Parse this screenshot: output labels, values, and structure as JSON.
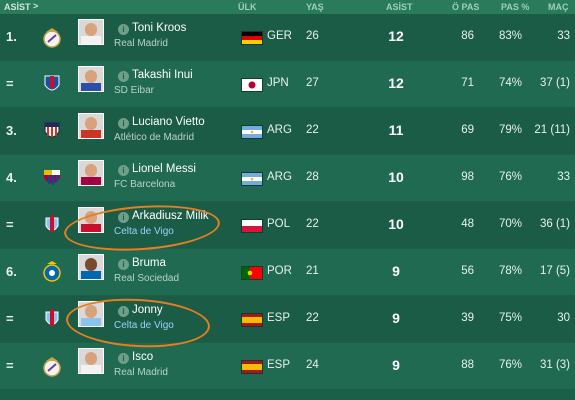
{
  "header": {
    "title": "ASİST",
    "chevron": ">",
    "columns": {
      "nation": "ÜLK",
      "age": "YAŞ",
      "assists": "ASİST",
      "passes": "Ö PAS",
      "pass_pct": "PAS %",
      "apps": "MAÇ"
    }
  },
  "players": [
    {
      "rank": "1.",
      "name": "Toni Kroos",
      "club": "Real Madrid",
      "nation": "GER",
      "age": "26",
      "assists": "12",
      "passes": "86",
      "pass_pct": "83%",
      "apps": "33",
      "badge_icon": "real-madrid-badge-icon",
      "flag_icon": "germany-flag-icon"
    },
    {
      "rank": "=",
      "name": "Takashi Inui",
      "club": "SD Eibar",
      "nation": "JPN",
      "age": "27",
      "assists": "12",
      "passes": "71",
      "pass_pct": "74%",
      "apps": "37 (1)",
      "badge_icon": "eibar-badge-icon",
      "flag_icon": "japan-flag-icon"
    },
    {
      "rank": "3.",
      "name": "Luciano Vietto",
      "club": "Atlético de Madrid",
      "nation": "ARG",
      "age": "22",
      "assists": "11",
      "passes": "69",
      "pass_pct": "79%",
      "apps": "21 (11)",
      "badge_icon": "atletico-badge-icon",
      "flag_icon": "argentina-flag-icon"
    },
    {
      "rank": "4.",
      "name": "Lionel Messi",
      "club": "FC Barcelona",
      "nation": "ARG",
      "age": "28",
      "assists": "10",
      "passes": "98",
      "pass_pct": "76%",
      "apps": "33",
      "badge_icon": "barcelona-badge-icon",
      "flag_icon": "argentina-flag-icon"
    },
    {
      "rank": "=",
      "name": "Arkadiusz Milik",
      "club": "Celta de Vigo",
      "nation": "POL",
      "age": "22",
      "assists": "10",
      "passes": "48",
      "pass_pct": "70%",
      "apps": "36 (1)",
      "badge_icon": "celta-badge-icon",
      "flag_icon": "poland-flag-icon"
    },
    {
      "rank": "6.",
      "name": "Bruma",
      "club": "Real Sociedad",
      "nation": "POR",
      "age": "21",
      "assists": "9",
      "passes": "56",
      "pass_pct": "78%",
      "apps": "17 (5)",
      "badge_icon": "real-sociedad-badge-icon",
      "flag_icon": "portugal-flag-icon"
    },
    {
      "rank": "=",
      "name": "Jonny",
      "club": "Celta de Vigo",
      "nation": "ESP",
      "age": "22",
      "assists": "9",
      "passes": "39",
      "pass_pct": "75%",
      "apps": "30",
      "badge_icon": "celta-badge-icon",
      "flag_icon": "spain-flag-icon"
    },
    {
      "rank": "=",
      "name": "Isco",
      "club": "Real Madrid",
      "nation": "ESP",
      "age": "24",
      "assists": "9",
      "passes": "88",
      "pass_pct": "76%",
      "apps": "31 (3)",
      "badge_icon": "real-madrid-badge-icon",
      "flag_icon": "spain-flag-icon"
    }
  ],
  "info_glyph": "i",
  "colors": {
    "highlight_circle": "#e67e22",
    "row_odd": "#1a5c46",
    "row_even": "#1f6a51",
    "header_bg": "#2a7a5c"
  }
}
